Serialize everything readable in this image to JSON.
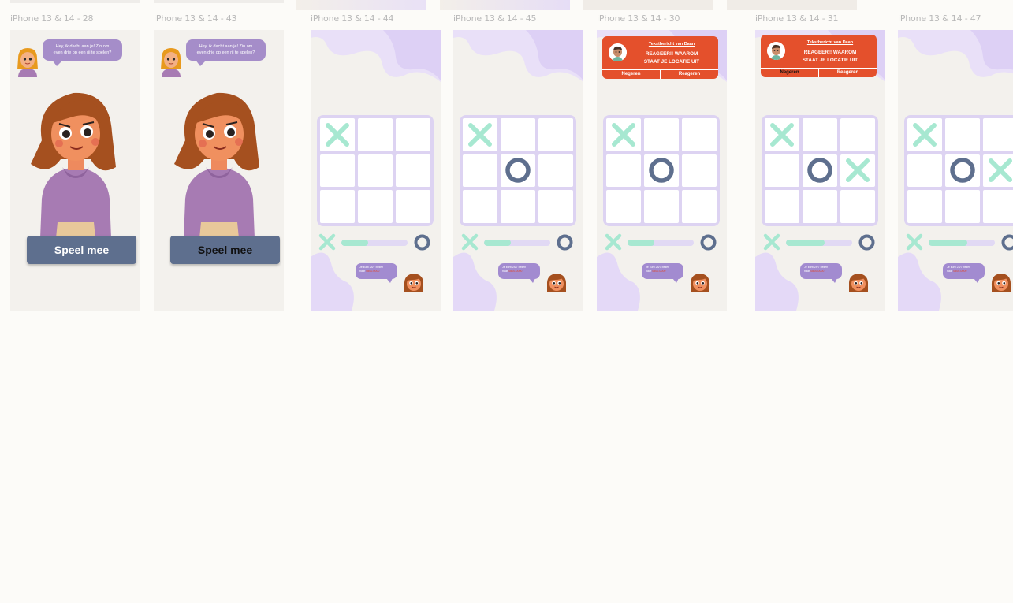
{
  "colors": {
    "canvas": "#fcfbf8",
    "frame_bg": "#f3f1ed",
    "purple": "#a58dc9",
    "lavender": "#ddd3f2",
    "mint": "#a7e8d1",
    "navy": "#5e6f8e",
    "orange": "#e4502c",
    "hoodie": "#a77bb3"
  },
  "frames": [
    {
      "label": "iPhone 13 & 14 - 28"
    },
    {
      "label": "iPhone 13 & 14 - 43"
    },
    {
      "label": "iPhone 13 & 14 - 44"
    },
    {
      "label": "iPhone 13 & 14 - 45"
    },
    {
      "label": "iPhone 13 & 14 - 30"
    },
    {
      "label": "iPhone 13 & 14 - 31"
    },
    {
      "label": "iPhone 13 & 14 - 47"
    }
  ],
  "intro": {
    "speech_line1": "Hey, ik dacht aan je! Zin om",
    "speech_line2": "even drie op een rij te spelen?",
    "play_label": "Speel mee"
  },
  "game": {
    "help_line1": "Je kunt 24/7 bellen",
    "help_line2_prefix": "naar",
    "help_line2_number": "0800-0000",
    "x_progress": 0.4
  },
  "notification": {
    "from": "Tekstbericht van Daan",
    "line1": "REAGEER!! WAAROM",
    "line2": "STAAT JE LOCATIE UIT",
    "ignore": "Negeren",
    "reply": "Reageren"
  }
}
